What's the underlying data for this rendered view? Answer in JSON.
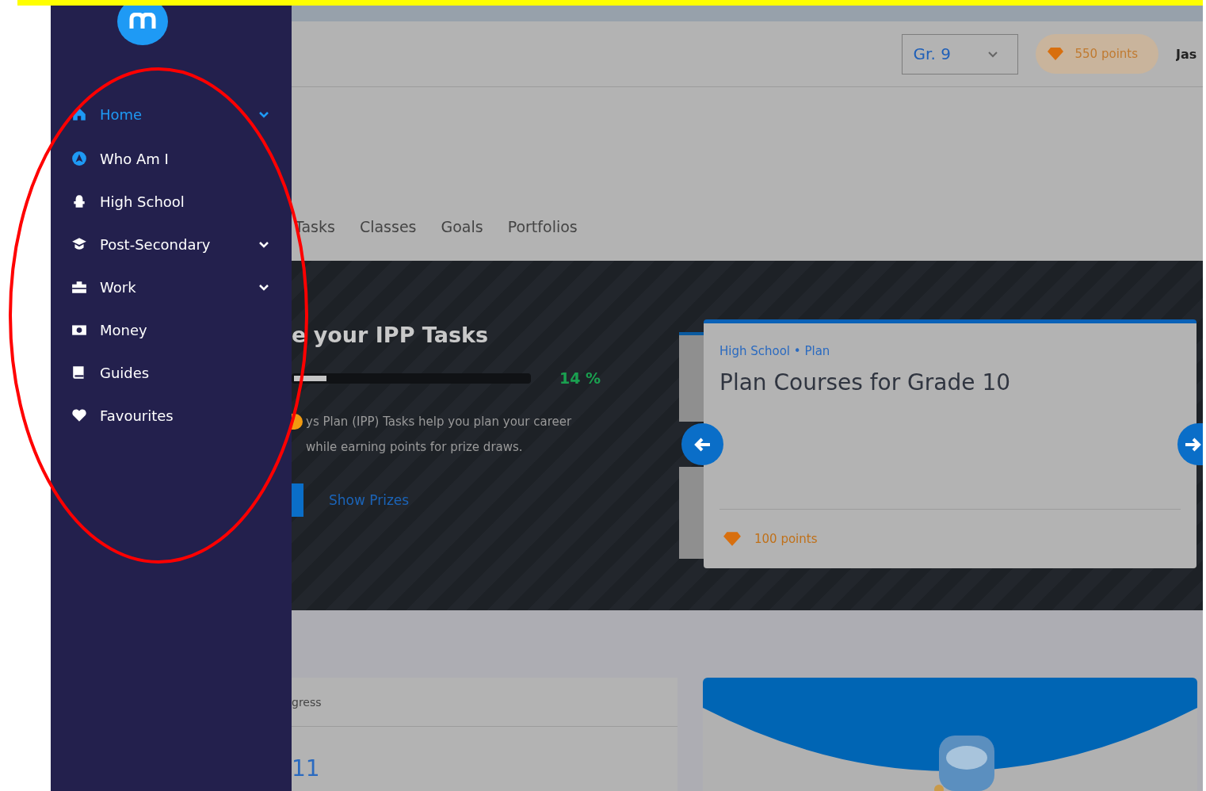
{
  "sidebar": {
    "items": [
      {
        "label": "Home",
        "selected": true,
        "expandable": true
      },
      {
        "label": "Who Am I",
        "selected": false,
        "expandable": false
      },
      {
        "label": "High School",
        "selected": false,
        "expandable": false
      },
      {
        "label": "Post-Secondary",
        "selected": false,
        "expandable": true
      },
      {
        "label": "Work",
        "selected": false,
        "expandable": true
      },
      {
        "label": "Money",
        "selected": false,
        "expandable": false
      },
      {
        "label": "Guides",
        "selected": false,
        "expandable": false
      },
      {
        "label": "Favourites",
        "selected": false,
        "expandable": false
      }
    ]
  },
  "header": {
    "grade": "Gr. 9",
    "points": "550 points",
    "user": "Jas"
  },
  "tabs": [
    {
      "label": "Tasks"
    },
    {
      "label": "Classes"
    },
    {
      "label": "Goals"
    },
    {
      "label": "Portfolios"
    }
  ],
  "banner": {
    "title": "e your IPP Tasks",
    "progress": {
      "level": 0.14,
      "reading": "14 %"
    },
    "description": "ys Plan (IPP) Tasks help you plan your career while earning points for prize draws.",
    "link": "Show Prizes",
    "card": {
      "category": "High School • Plan",
      "title": "Plan Courses for Grade 10",
      "points": "100 points"
    }
  },
  "progress_card": {
    "heading": "gress",
    "value": "11"
  }
}
